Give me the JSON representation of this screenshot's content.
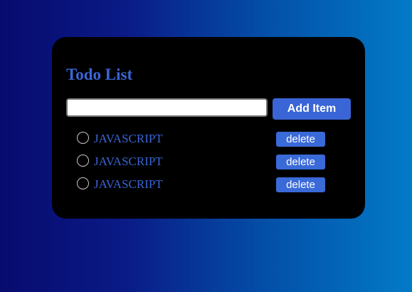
{
  "app": {
    "title": "Todo List"
  },
  "input": {
    "value": "",
    "placeholder": ""
  },
  "add_button": {
    "label": "Add Item"
  },
  "todos": [
    {
      "text": "JAVASCRIPT",
      "done": false,
      "delete_label": "delete"
    },
    {
      "text": "JAVASCRIPT",
      "done": false,
      "delete_label": "delete"
    },
    {
      "text": "JAVASCRIPT",
      "done": false,
      "delete_label": "delete"
    }
  ],
  "colors": {
    "accent": "#3a65d6",
    "card_background": "#000000",
    "gradient_start": "#070b6e",
    "gradient_end": "#037ac7"
  },
  "icons": {
    "checkbox": "circle-outline-icon"
  }
}
